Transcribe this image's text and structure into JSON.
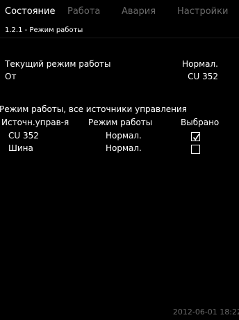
{
  "tabs": [
    {
      "label": "Состояние",
      "active": true
    },
    {
      "label": "Работа",
      "active": false
    },
    {
      "label": "Авария",
      "active": false
    },
    {
      "label": "Настройки",
      "active": false
    }
  ],
  "page": {
    "subtitle": "1.2.1 - Режим работы"
  },
  "current": {
    "mode_label": "Текущий режим работы",
    "mode_value": "Нормал.",
    "source_label": "От",
    "source_value": "CU 352"
  },
  "sources": {
    "heading": "Режим работы, все источники управления",
    "columns": [
      "Источн.управ-я",
      "Режим работы",
      "Выбрано"
    ],
    "rows": [
      {
        "source": "CU 352",
        "mode": "Нормал.",
        "selected": true
      },
      {
        "source": "Шина",
        "mode": "Нормал.",
        "selected": false
      }
    ]
  },
  "status": {
    "timestamp": "2012-06-01 18:22"
  },
  "colors": {
    "background": "#000000",
    "text": "#ffffff",
    "inactive": "#6a6a6a"
  }
}
